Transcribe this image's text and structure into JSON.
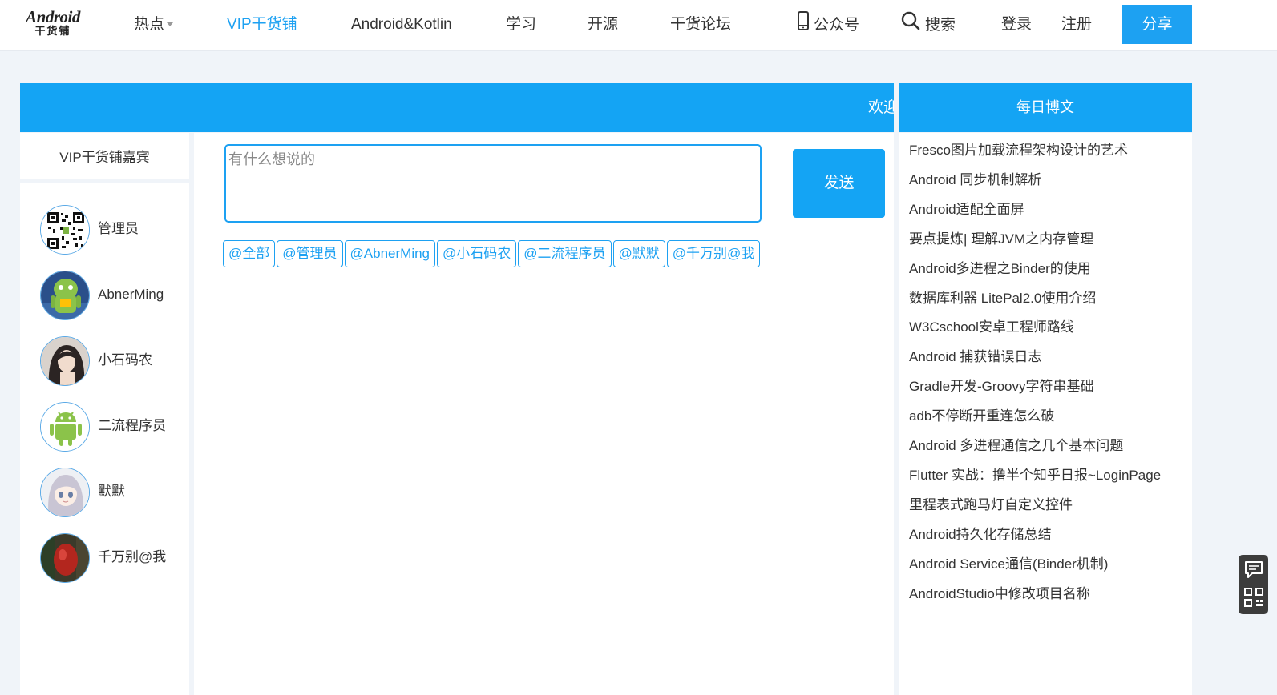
{
  "header": {
    "logo_main": "Android",
    "logo_sub": "干货铺",
    "nav": {
      "hot": "热点",
      "vip": "VIP干货铺",
      "android_kotlin": "Android&Kotlin",
      "study": "学习",
      "open_source": "开源",
      "forum": "干货论坛",
      "wechat": "公众号",
      "search": "搜索",
      "login": "登录",
      "register": "注册"
    },
    "share_label": "分享"
  },
  "main_banner": {
    "welcome_text": "欢迎"
  },
  "sidebar": {
    "title": "VIP干货铺嘉宾",
    "guests": [
      {
        "name": "管理员",
        "avatar": "qr-code-avatar"
      },
      {
        "name": "AbnerMing",
        "avatar": "android-robot-avatar"
      },
      {
        "name": "小石码农",
        "avatar": "photo-avatar"
      },
      {
        "name": "二流程序员",
        "avatar": "android-logo-avatar"
      },
      {
        "name": "默默",
        "avatar": "anime-girl-avatar"
      },
      {
        "name": "千万别@我",
        "avatar": "red-photo-avatar"
      }
    ]
  },
  "chat": {
    "input_placeholder": "有什么想说的",
    "send_label": "发送",
    "mention_tags": [
      "@全部",
      "@管理员",
      "@AbnerMing",
      "@小石码农",
      "@二流程序员",
      "@默默",
      "@千万别@我"
    ]
  },
  "blog": {
    "title": "每日博文",
    "items": [
      "Fresco图片加载流程架构设计的艺术",
      "Android 同步机制解析",
      "Android适配全面屏",
      "要点提炼| 理解JVM之内存管理",
      "Android多进程之Binder的使用",
      "数据库利器 LitePal2.0使用介绍",
      "W3Cschool安卓工程师路线",
      "Android 捕获错误日志",
      "Gradle开发-Groovy字符串基础",
      "adb不停断开重连怎么破",
      "Android 多进程通信之几个基本问题",
      "Flutter 实战：撸半个知乎日报~LoginPage",
      "里程表式跑马灯自定义控件",
      "Android持久化存储总结",
      "Android Service通信(Binder机制)",
      "AndroidStudio中修改项目名称"
    ]
  },
  "colors": {
    "accent": "#1da1f2",
    "banner": "#14a4f4",
    "page_bg": "#f0f4f9"
  }
}
